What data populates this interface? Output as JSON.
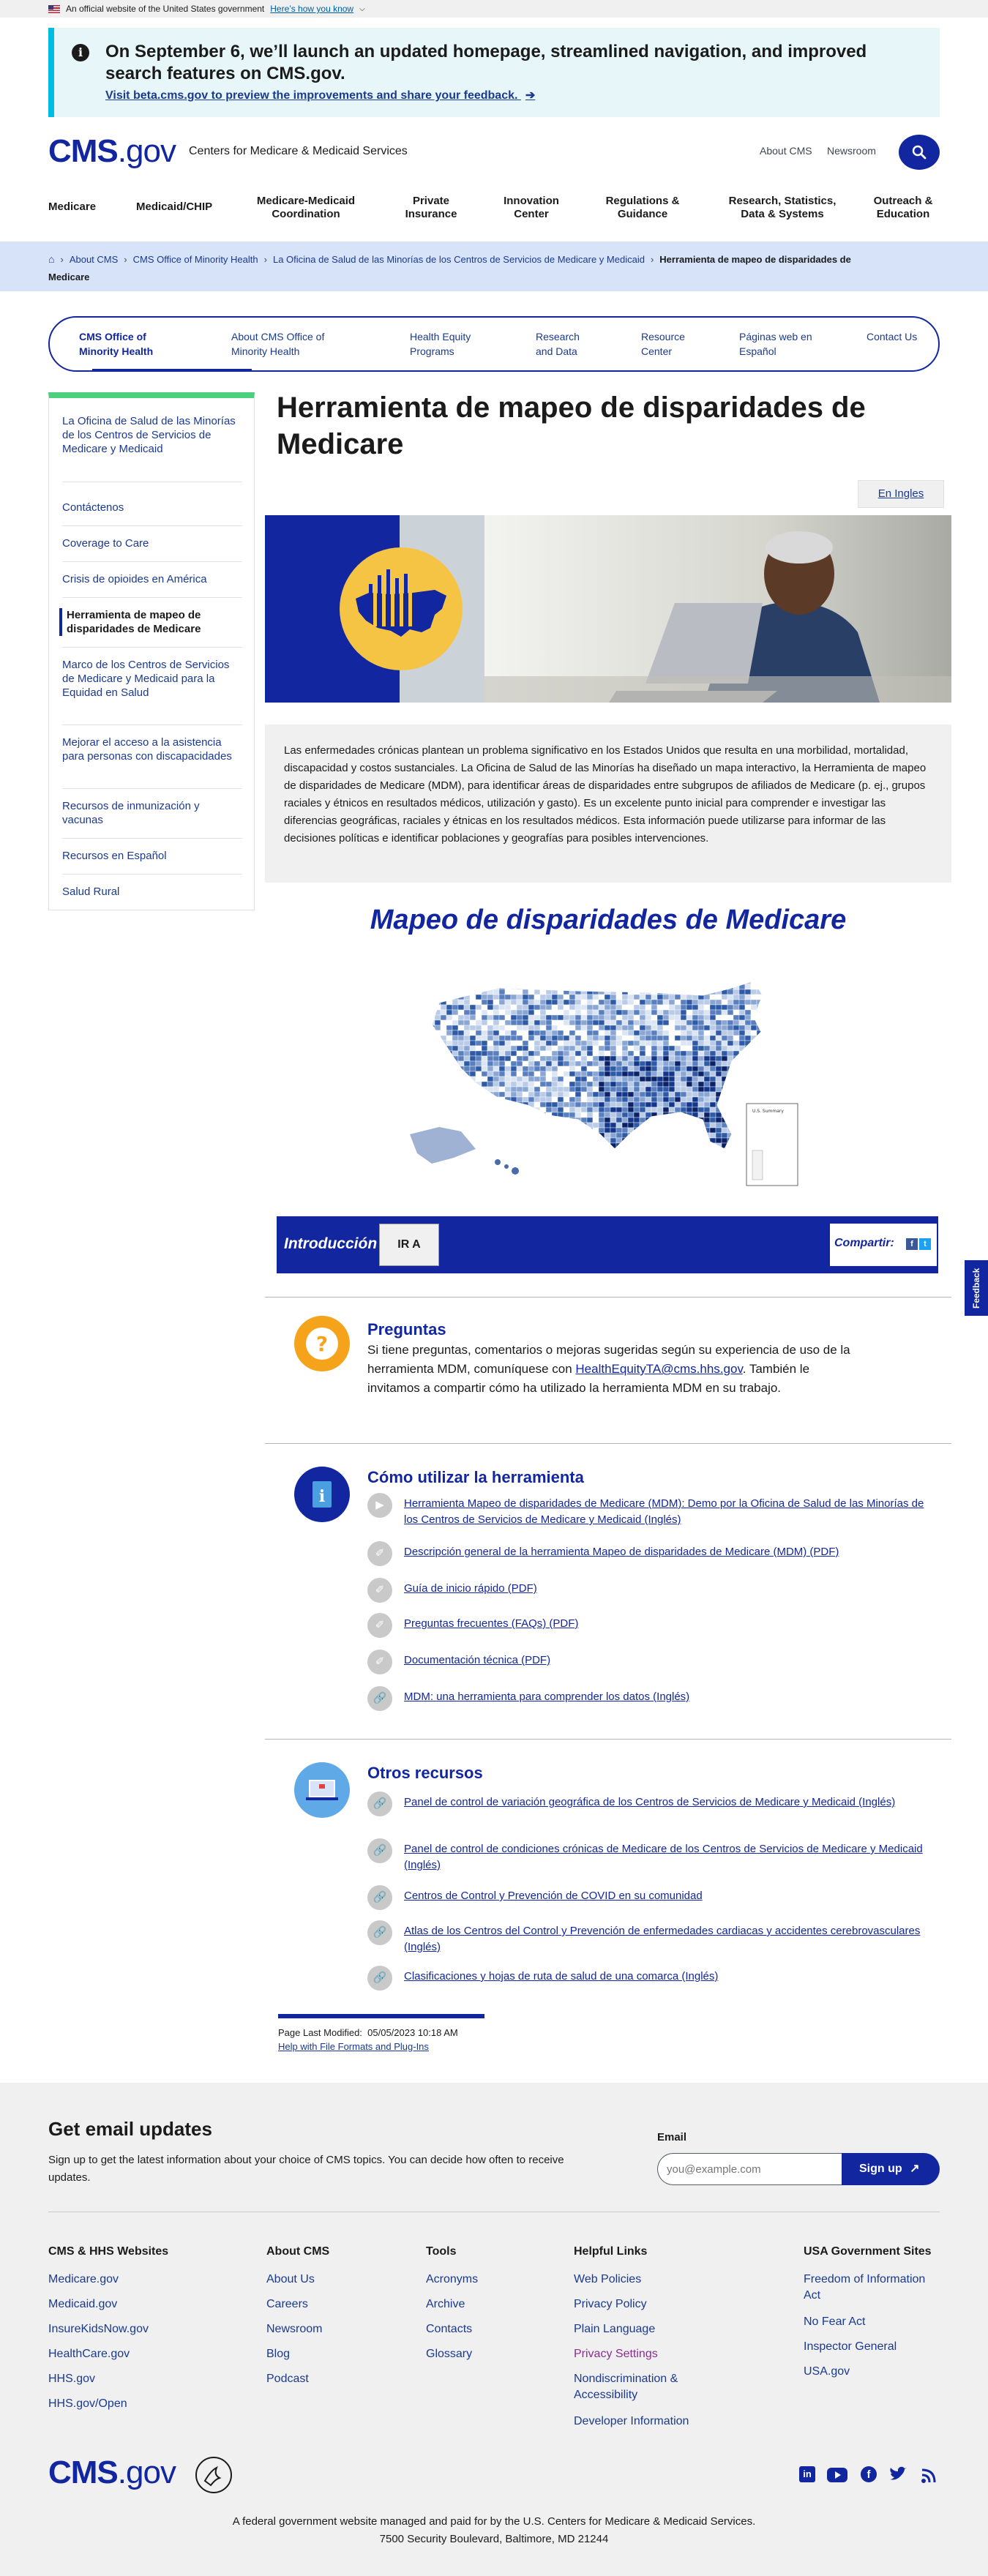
{
  "gov_banner": {
    "text": "An official website of the United States government",
    "link": "Here’s how you know"
  },
  "alert": {
    "title": "On September 6, we’ll launch an updated homepage, streamlined navigation, and improved search features on CMS.gov.",
    "link": "Visit beta.cms.gov to preview the improvements and share your feedback.",
    "link_arrow": "➔"
  },
  "header": {
    "logo_bold": "CMS",
    "logo_rest": ".gov",
    "site_name": "Centers for Medicare & Medicaid Services",
    "about_link": "About CMS",
    "newsroom_link": "Newsroom"
  },
  "main_nav": [
    "Medicare",
    "Medicaid/CHIP",
    "Medicare-Medicaid Coordination",
    "Private Insurance",
    "Innovation Center",
    "Regulations & Guidance",
    "Research, Statistics, Data & Systems",
    "Outreach & Education"
  ],
  "breadcrumb": {
    "items": [
      "About CMS",
      "CMS Office of Minority Health",
      "La Oficina de Salud de las Minorías de los Centros de Servicios de Medicare y Medicaid"
    ],
    "current": "Herramienta de mapeo de disparidades de Medicare",
    "separator": "›"
  },
  "subnav": [
    "CMS Office of Minority Health",
    "About CMS Office of Minority Health",
    "Health Equity Programs",
    "Research and Data",
    "Resource Center",
    "Páginas web en Español",
    "Contact Us"
  ],
  "sidebar": [
    "La Oficina de Salud de las Minorías de los Centros de Servicios de Medicare y Medicaid",
    "Contáctenos",
    "Coverage to Care",
    "Crisis de opioides en América",
    "Herramienta de mapeo de disparidades de Medicare",
    "Marco de los Centros de Servicios de Medicare y Medicaid para la Equidad en Salud",
    "Mejorar el acceso a la asistencia para personas con discapacidades",
    "Recursos de inmunización y vacunas",
    "Recursos en Español",
    "Salud Rural"
  ],
  "content": {
    "title": "Herramienta de mapeo de disparidades de Medicare",
    "lang_button": "En Ingles",
    "intro": "Las enfermedades crónicas plantean un problema significativo en los Estados Unidos que resulta en una morbilidad, mortalidad, discapacidad y costos sustanciales. La Oficina de Salud de las Minorías ha diseñado un mapa interactivo, la Herramienta de mapeo de disparidades de Medicare (MDM), para identificar áreas de disparidades entre subgrupos de afiliados de Medicare (p. ej., grupos raciales y étnicos en resultados médicos, utilización y gasto). Es un excelente punto inicial para comprender e investigar las diferencias geográficas, raciales y étnicas en los resultados médicos. Esta información puede utilizarse para informar de las decisiones políticas e identificar poblaciones y geografías para posibles intervenciones.",
    "map_title": "Mapeo de disparidades de Medicare",
    "map_legend": "U.S. Summary",
    "toolbar": {
      "intro": "Introducción",
      "go": "IR A",
      "share": "Compartir:"
    }
  },
  "preguntas": {
    "title": "Preguntas",
    "text_before": "Si tiene preguntas, comentarios o mejoras sugeridas según su experiencia de uso de la herramienta MDM, comuníquese con ",
    "email": "HealthEquityTA@cms.hhs.gov",
    "text_after": ". También le invitamos a compartir cómo ha utilizado la herramienta MDM en su trabajo."
  },
  "como": {
    "title": "Cómo utilizar la herramienta",
    "links": [
      "Herramienta Mapeo de disparidades de Medicare (MDM): Demo por la Oficina de Salud de las Minorías de los Centros de Servicios de Medicare y Medicaid (Inglés)",
      "Descripción general de la herramienta Mapeo de disparidades de Medicare (MDM) (PDF)",
      "Guía de inicio rápido (PDF)",
      "Preguntas frecuentes (FAQs) (PDF)",
      "Documentación técnica (PDF)",
      "MDM: una herramienta para comprender los datos (Inglés)"
    ]
  },
  "otros": {
    "title": "Otros recursos",
    "links": [
      "Panel de control de variación geográfica de los Centros de Servicios de Medicare y Medicaid (Inglés)",
      "Panel de control de condiciones crónicas de Medicare de los Centros de Servicios de Medicare y Medicaid (Inglés)",
      "Centros de Control y Prevención de COVID en su comunidad",
      "Atlas de los Centros del Control y Prevención de enfermedades cardiacas y accidentes cerebrovasculares (Inglés)",
      "Clasificaciones y hojas de ruta de salud de una comarca (Inglés)"
    ]
  },
  "modified": {
    "label": "Page Last Modified:",
    "date": "05/05/2023 10:18 AM",
    "help": "Help with File Formats and Plug-Ins"
  },
  "email_updates": {
    "title": "Get email updates",
    "text": "Sign up to get the latest information about your choice of CMS topics. You can decide how often to receive updates.",
    "label": "Email",
    "placeholder": "you@example.com",
    "button": "Sign up"
  },
  "footer": {
    "columns": [
      {
        "title": "CMS & HHS Websites",
        "links": [
          "Medicare.gov",
          "Medicaid.gov",
          "InsureKidsNow.gov",
          "HealthCare.gov",
          "HHS.gov",
          "HHS.gov/Open"
        ]
      },
      {
        "title": "About CMS",
        "links": [
          "About Us",
          "Careers",
          "Newsroom",
          "Blog",
          "Podcast"
        ]
      },
      {
        "title": "Tools",
        "links": [
          "Acronyms",
          "Archive",
          "Contacts",
          "Glossary"
        ]
      },
      {
        "title": "Helpful Links",
        "links": [
          "Web Policies",
          "Privacy Policy",
          "Plain Language",
          "Privacy Settings",
          "Nondiscrimination & Accessibility",
          "Developer Information"
        ]
      },
      {
        "title": "USA Government Sites",
        "links": [
          "Freedom of Information Act",
          "No Fear Act",
          "Inspector General",
          "USA.gov"
        ]
      }
    ],
    "bottom_line1": "A federal government website managed and paid for by the U.S. Centers for Medicare & Medicaid Services.",
    "bottom_line2": "7500 Security Boulevard, Baltimore, MD 21244"
  },
  "feedback_tab": "Feedback",
  "colors": {
    "primary": "#12279f",
    "accent_green": "#4cd07d",
    "alert_border": "#00bde3",
    "hero_yellow": "#f5c445",
    "visited": "#8a2f8f"
  }
}
